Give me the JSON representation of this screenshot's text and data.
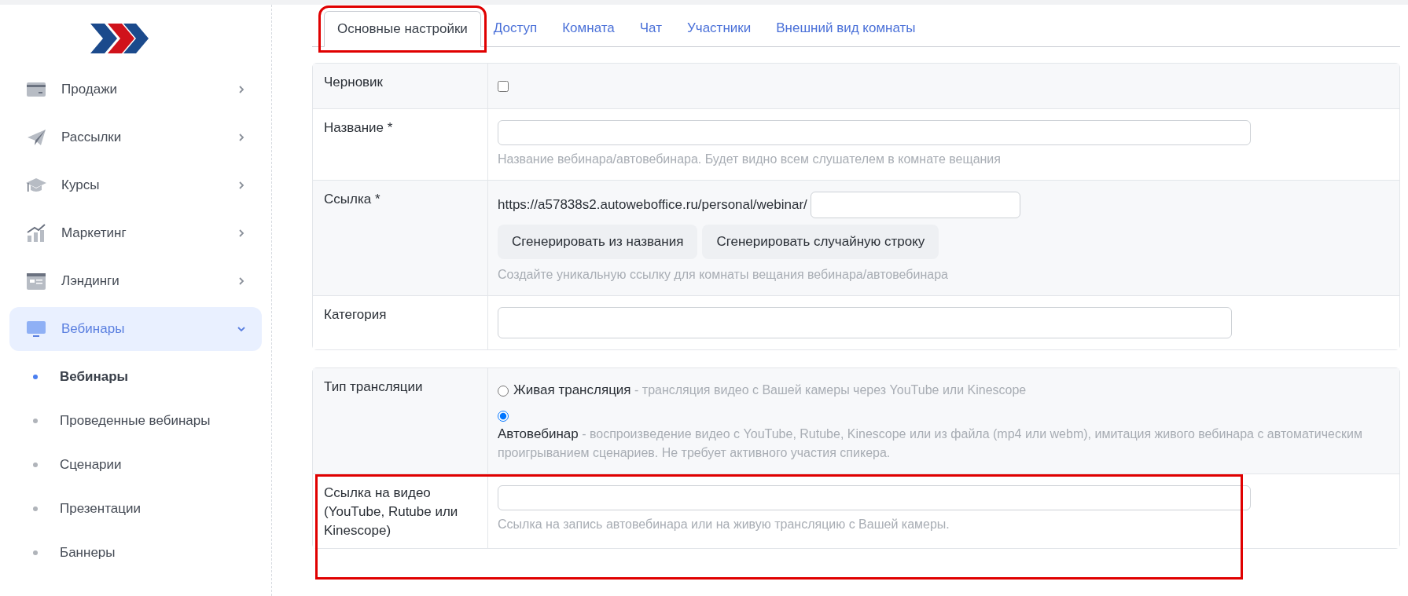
{
  "sidebar": {
    "items": [
      {
        "label": "Продажи",
        "expanded": false,
        "selected": false,
        "notification": false
      },
      {
        "label": "Рассылки",
        "expanded": false,
        "selected": false,
        "notification": false
      },
      {
        "label": "Курсы",
        "expanded": false,
        "selected": false,
        "notification": false
      },
      {
        "label": "Маркетинг",
        "expanded": false,
        "selected": false,
        "notification": false
      },
      {
        "label": "Лэндинги",
        "expanded": false,
        "selected": false,
        "notification": false
      },
      {
        "label": "Вебинары",
        "expanded": true,
        "selected": true,
        "notification": false,
        "children": [
          {
            "label": "Вебинары",
            "selected": true
          },
          {
            "label": "Проведенные вебинары",
            "selected": false
          },
          {
            "label": "Сценарии",
            "selected": false
          },
          {
            "label": "Презентации",
            "selected": false
          },
          {
            "label": "Баннеры",
            "selected": false
          }
        ]
      }
    ]
  },
  "tabs": [
    {
      "label": "Основные настройки",
      "selected": true,
      "highlighted": true
    },
    {
      "label": "Доступ",
      "selected": false,
      "highlighted": false
    },
    {
      "label": "Комната",
      "selected": false,
      "highlighted": false
    },
    {
      "label": "Чат",
      "selected": false,
      "highlighted": false
    },
    {
      "label": "Участники",
      "selected": false,
      "highlighted": false
    },
    {
      "label": "Внешний вид комнаты",
      "selected": false,
      "highlighted": false
    }
  ],
  "sections": [
    {
      "rows": [
        {
          "kind": "checkbox",
          "label": "Черновик",
          "checked": false,
          "highlighted": false
        },
        {
          "kind": "input",
          "label": "Название *",
          "hint": "Название вебинара/автовебинара. Будет видно всем слушателем в комнате вещания",
          "highlighted": false
        },
        {
          "kind": "link",
          "label": "Ссылка *",
          "prefix": "https://a57838s2.autoweboffice.ru/personal/webinar/",
          "buttons": [
            "Сгенерировать из названия",
            "Сгенерировать случайную строку"
          ],
          "hint": "Создайте уникальную ссылку для комнаты вещания вебинара/автовебинара",
          "highlighted": false
        },
        {
          "kind": "select",
          "label": "Категория",
          "highlighted": false
        }
      ]
    },
    {
      "rows": [
        {
          "kind": "radio",
          "label": "Тип трансляции",
          "highlighted": false,
          "options": [
            {
              "label": "Живая трансляция",
              "description": " - трансляция видео с Вашей камеры через YouTube или Kinescope",
              "selected": false
            },
            {
              "label": "Автовебинар",
              "description": " - воспроизведение видео с YouTube, Rutube, Kinescope или из файла (mp4 или webm), имитация живого вебинара с автоматическим проигрыванием сценариев. Не требует активного участия спикера.",
              "selected": true
            }
          ]
        },
        {
          "kind": "input",
          "label": "Ссылка на видео (YouTube, Rutube или Kinescope)",
          "hint": "Ссылка на запись автовебинара или на живую трансляцию с Вашей камеры.",
          "highlighted": true
        }
      ]
    }
  ]
}
